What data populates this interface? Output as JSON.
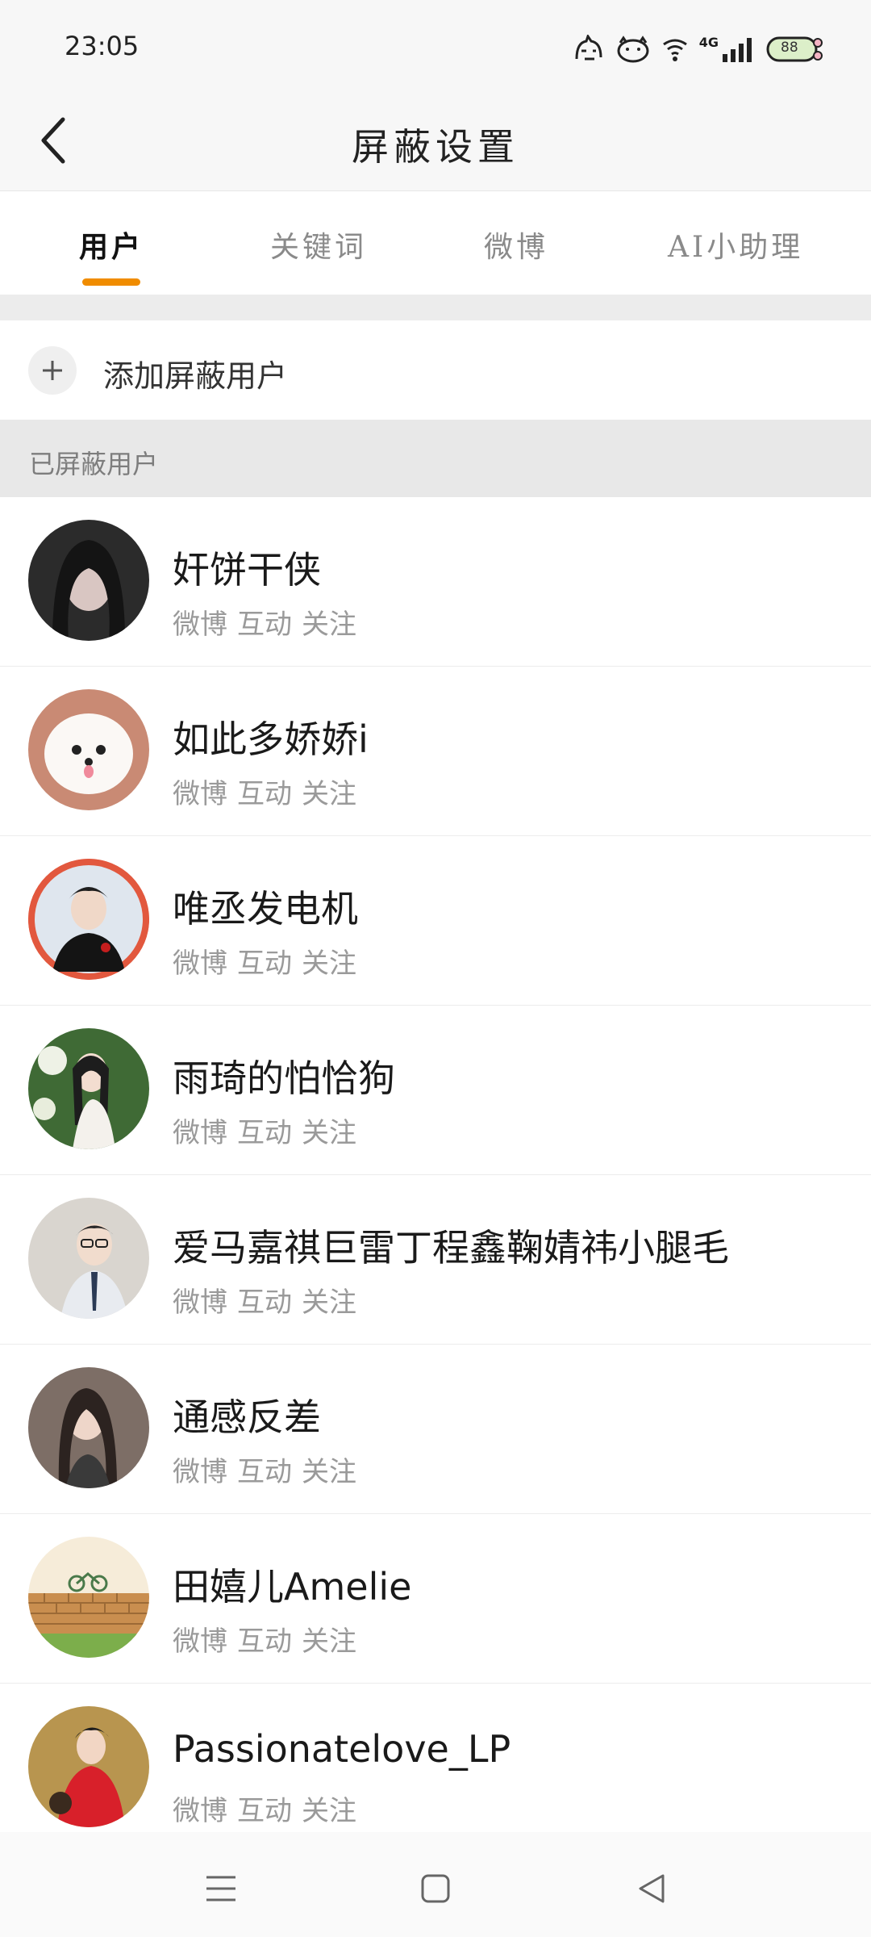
{
  "status_bar": {
    "time": "23:05",
    "network": "4G",
    "battery": "88",
    "icons": [
      "pet-icon",
      "face-icon",
      "wifi-icon",
      "signal-icon",
      "battery-icon"
    ]
  },
  "header": {
    "title": "屏蔽设置",
    "back_icon": "back-arrow-icon"
  },
  "tabs": [
    {
      "label": "用户",
      "active": true
    },
    {
      "label": "关键词",
      "active": false
    },
    {
      "label": "微博",
      "active": false
    },
    {
      "label": "AI小助理",
      "active": false
    }
  ],
  "add_row": {
    "label": "添加屏蔽用户",
    "icon": "plus-icon"
  },
  "section": {
    "title": "已屏蔽用户"
  },
  "users": [
    {
      "name": "奸饼干侠",
      "tags": [
        "微博",
        "互动",
        "关注"
      ]
    },
    {
      "name": "如此多娇娇i",
      "tags": [
        "微博",
        "互动",
        "关注"
      ]
    },
    {
      "name": "唯丞发电机",
      "tags": [
        "微博",
        "互动",
        "关注"
      ]
    },
    {
      "name": "雨琦的怕恰狗",
      "tags": [
        "微博",
        "互动",
        "关注"
      ]
    },
    {
      "name": "爱马嘉祺巨雷丁程鑫鞠婧祎小腿毛",
      "tags": [
        "微博",
        "互动",
        "关注"
      ]
    },
    {
      "name": "通感反差",
      "tags": [
        "微博",
        "互动",
        "关注"
      ]
    },
    {
      "name": "田嬉儿Amelie",
      "tags": [
        "微博",
        "互动",
        "关注"
      ]
    },
    {
      "name": "Passionatelove_LP",
      "tags": [
        "微博",
        "互动",
        "关注"
      ]
    }
  ],
  "colors": {
    "accent": "#f08c00",
    "avatar_ring": "#e2583e"
  },
  "nav_bar": {
    "icons": [
      "menu-icon",
      "home-square-icon",
      "back-triangle-icon"
    ]
  }
}
